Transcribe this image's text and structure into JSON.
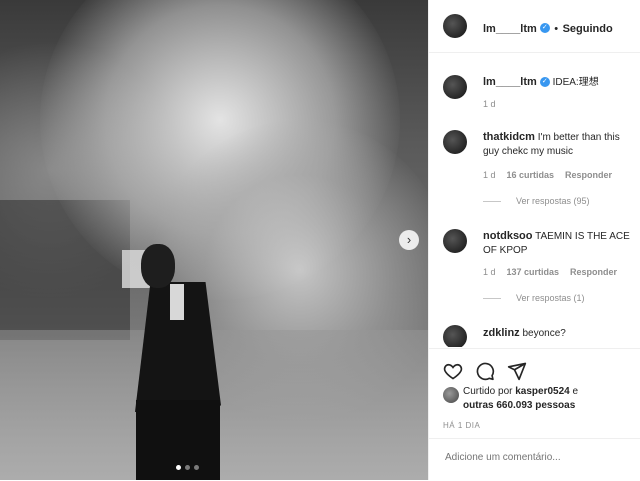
{
  "post": {
    "author": "lm____ltm",
    "follow_separator": "•",
    "follow_label": "Seguindo",
    "caption": "IDEA:理想",
    "caption_age": "1 d",
    "next_icon": "chevron-right-icon",
    "carousel_count": 3,
    "carousel_active": 1
  },
  "comments": [
    {
      "user": "thatkidcm",
      "text": "I'm better than this guy chekc my music",
      "age": "1 d",
      "likes": "16 curtidas",
      "reply": "Responder",
      "view_replies": "Ver respostas (95)"
    },
    {
      "user": "notdksoo",
      "text": "TAEMIN IS THE ACE OF KPOP",
      "age": "1 d",
      "likes": "137 curtidas",
      "reply": "Responder",
      "view_replies": "Ver respostas (1)"
    },
    {
      "user": "zdklinz",
      "text": "beyonce?"
    }
  ],
  "actions": {
    "like_icon": "heart-icon",
    "comment_icon": "comment-icon",
    "share_icon": "send-icon",
    "liked_by_prefix": "Curtido por",
    "liked_by_user": "kasper0524",
    "liked_by_mid": "e",
    "liked_by_others": "outras 660.093 pessoas",
    "post_time": "HÁ 1 DIA"
  },
  "add_comment": {
    "placeholder": "Adicione um comentário..."
  }
}
